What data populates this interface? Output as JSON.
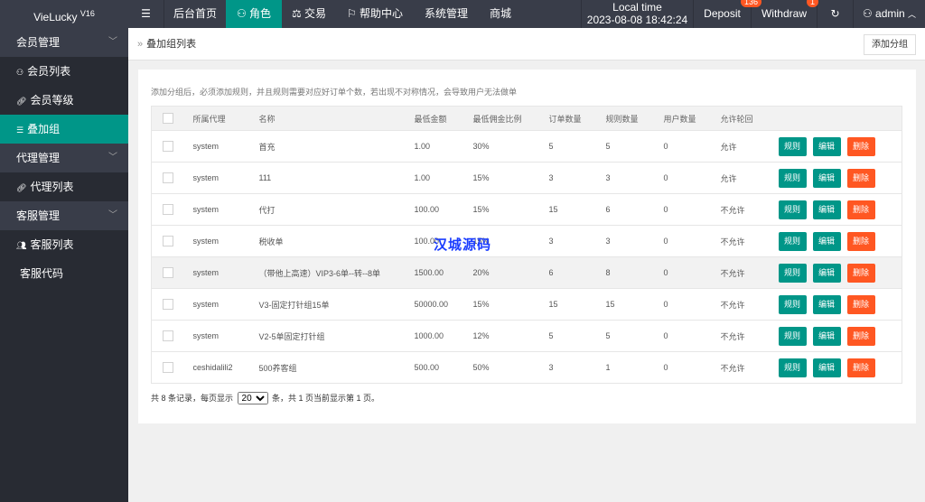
{
  "top": {
    "logo": "VieLucky",
    "version": "V16",
    "menu_icon": "☰",
    "nav": [
      "后台首页",
      "角色",
      "交易",
      "帮助中心",
      "系统管理",
      "商城"
    ],
    "active_nav": 1,
    "local_time_label": "Local time",
    "local_time": "2023-08-08 18:42:24",
    "deposit": "Deposit",
    "deposit_badge": "136",
    "withdraw": "Withdraw",
    "withdraw_badge": "1",
    "user": "admin"
  },
  "sidebar": {
    "groups": [
      {
        "label": "会员管理",
        "items": [
          {
            "label": "会员列表",
            "icon": "user-icon"
          },
          {
            "label": "会员等级",
            "icon": "link-icon"
          },
          {
            "label": "叠加组",
            "icon": "list-icon",
            "active": true
          }
        ]
      },
      {
        "label": "代理管理",
        "items": [
          {
            "label": "代理列表",
            "icon": "link-icon"
          }
        ]
      },
      {
        "label": "客服管理",
        "items": [
          {
            "label": "客服列表",
            "icon": "users-icon"
          },
          {
            "label": "客服代码",
            "icon": "code-icon"
          }
        ]
      }
    ]
  },
  "breadcrumb": "叠加组列表",
  "add_button": "添加分组",
  "note": "添加分组后，必须添加规则，并且规则需要对应好订单个数，若出现不对称情况，会导致用户无法做单",
  "table": {
    "headers": [
      "所属代理",
      "名称",
      "最低金额",
      "最低佣金比例",
      "订单数量",
      "规则数量",
      "用户数量",
      "允许轮回"
    ],
    "actions": [
      "规则",
      "编辑",
      "删除"
    ],
    "rows": [
      [
        "system",
        "首充",
        "1.00",
        "30%",
        "5",
        "5",
        "0",
        "允许"
      ],
      [
        "system",
        "111",
        "1.00",
        "15%",
        "3",
        "3",
        "0",
        "允许"
      ],
      [
        "system",
        "代打",
        "100.00",
        "15%",
        "15",
        "6",
        "0",
        "不允许"
      ],
      [
        "system",
        "税收单",
        "100.00",
        "15%",
        "3",
        "3",
        "0",
        "不允许"
      ],
      [
        "system",
        "（带他上高速）VIP3-6单--转--8单",
        "1500.00",
        "20%",
        "6",
        "8",
        "0",
        "不允许"
      ],
      [
        "system",
        "V3-固定打针组15单",
        "50000.00",
        "15%",
        "15",
        "15",
        "0",
        "不允许"
      ],
      [
        "system",
        "V2-5单固定打针组",
        "1000.00",
        "12%",
        "5",
        "5",
        "0",
        "不允许"
      ],
      [
        "ceshidalili2",
        "500养客组",
        "500.00",
        "50%",
        "3",
        "1",
        "0",
        "不允许"
      ]
    ]
  },
  "pager": {
    "prefix": "共 8 条记录，每页显示",
    "page_size": "20",
    "suffix": "条，共 1 页当前显示第 1 页。"
  },
  "watermark": "汉城源码"
}
